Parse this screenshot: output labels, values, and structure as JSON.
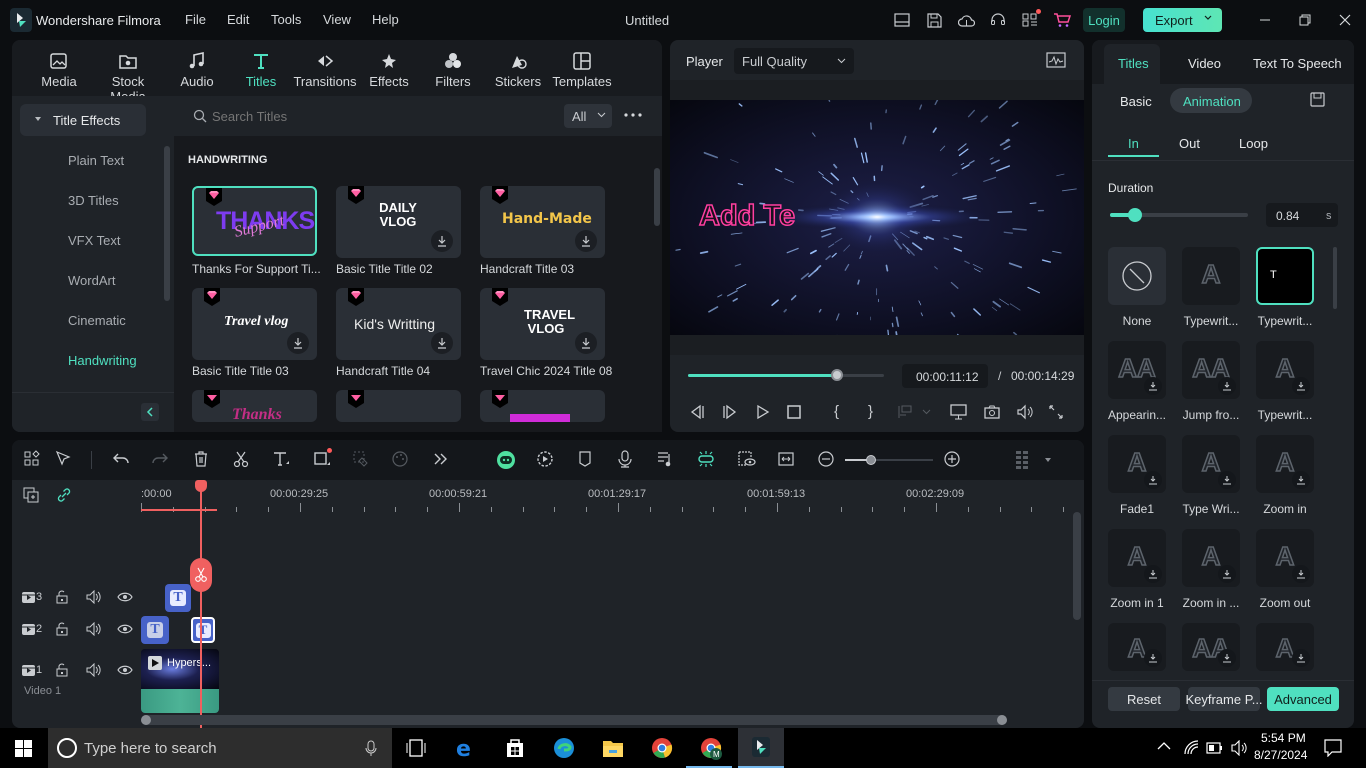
{
  "app": {
    "name": "Wondershare Filmora",
    "project_title": "Untitled",
    "menu": [
      "File",
      "Edit",
      "Tools",
      "View",
      "Help"
    ],
    "login_label": "Login",
    "export_label": "Export",
    "accent_color": "#4fe0c0"
  },
  "toolbar_icons": [
    "layout-icon",
    "save-icon",
    "cloud-upload-icon",
    "headset-icon",
    "apps-icon",
    "cart-icon"
  ],
  "nav": {
    "items": [
      {
        "label": "Media",
        "icon": "media-icon"
      },
      {
        "label": "Stock Media",
        "icon": "stock-media-icon"
      },
      {
        "label": "Audio",
        "icon": "audio-icon"
      },
      {
        "label": "Titles",
        "icon": "titles-icon",
        "active": true
      },
      {
        "label": "Transitions",
        "icon": "transitions-icon"
      },
      {
        "label": "Effects",
        "icon": "effects-icon"
      },
      {
        "label": "Filters",
        "icon": "filters-icon"
      },
      {
        "label": "Stickers",
        "icon": "stickers-icon"
      },
      {
        "label": "Templates",
        "icon": "templates-icon"
      }
    ]
  },
  "library": {
    "category_header": "Title Effects",
    "categories": [
      "Plain Text",
      "3D Titles",
      "VFX Text",
      "WordArt",
      "Cinematic",
      "Handwriting"
    ],
    "active_category": "Handwriting",
    "search_placeholder": "Search Titles",
    "filter_value": "All",
    "section_heading": "HANDWRITING",
    "cards": [
      {
        "title": "Thanks For Support Ti...",
        "preview": "THANKS",
        "selected": true
      },
      {
        "title": "Basic Title Title 02",
        "preview": "DAILY VLOG"
      },
      {
        "title": "Handcraft Title 03",
        "preview": "Hand-Made"
      },
      {
        "title": "Basic Title Title 03",
        "preview": "Travel vlog"
      },
      {
        "title": "Handcraft Title 04",
        "preview": "Kid's Writting"
      },
      {
        "title": "Travel Chic 2024 Title 08",
        "preview": "TRAVEL VLOG"
      }
    ]
  },
  "player": {
    "label": "Player",
    "quality": "Full Quality",
    "overlay_text": "Add Te",
    "current_time": "00:00:11:12",
    "total_time": "00:00:14:29",
    "progress": 0.76,
    "separator": "/"
  },
  "right_panel": {
    "tabs": [
      "Titles",
      "Video",
      "Text To Speech"
    ],
    "active_tab": "Titles",
    "subtabs": [
      "Basic",
      "Animation"
    ],
    "active_subtab": "Animation",
    "anim_tabs": [
      "In",
      "Out",
      "Loop"
    ],
    "active_anim_tab": "In",
    "duration_label": "Duration",
    "duration_value": "0.84",
    "duration_unit": "s",
    "duration_fraction": 0.18,
    "animations": [
      "None",
      "Typewrit...",
      "Typewrit...",
      "Appearin...",
      "Jump fro...",
      "Typewrit...",
      "Fade1",
      "Type Wri...",
      "Zoom in",
      "Zoom in 1",
      "Zoom in ...",
      "Zoom out",
      "",
      "",
      ""
    ],
    "selected_animation_index": 2,
    "reset_label": "Reset",
    "keyframe_label": "Keyframe P...",
    "advanced_label": "Advanced"
  },
  "timeline": {
    "ruler": [
      ":00:00",
      "00:00:29:25",
      "00:00:59:21",
      "00:01:29:17",
      "00:01:59:13",
      "00:02:29:09"
    ],
    "tracks": [
      {
        "number": "3"
      },
      {
        "number": "2"
      },
      {
        "number": "1",
        "name": "Video 1"
      }
    ],
    "video_clip_label": "Hypers...",
    "zoom_level": 0.3
  },
  "taskbar": {
    "search_placeholder": "Type here to search",
    "time": "5:54 PM",
    "date": "8/27/2024"
  }
}
